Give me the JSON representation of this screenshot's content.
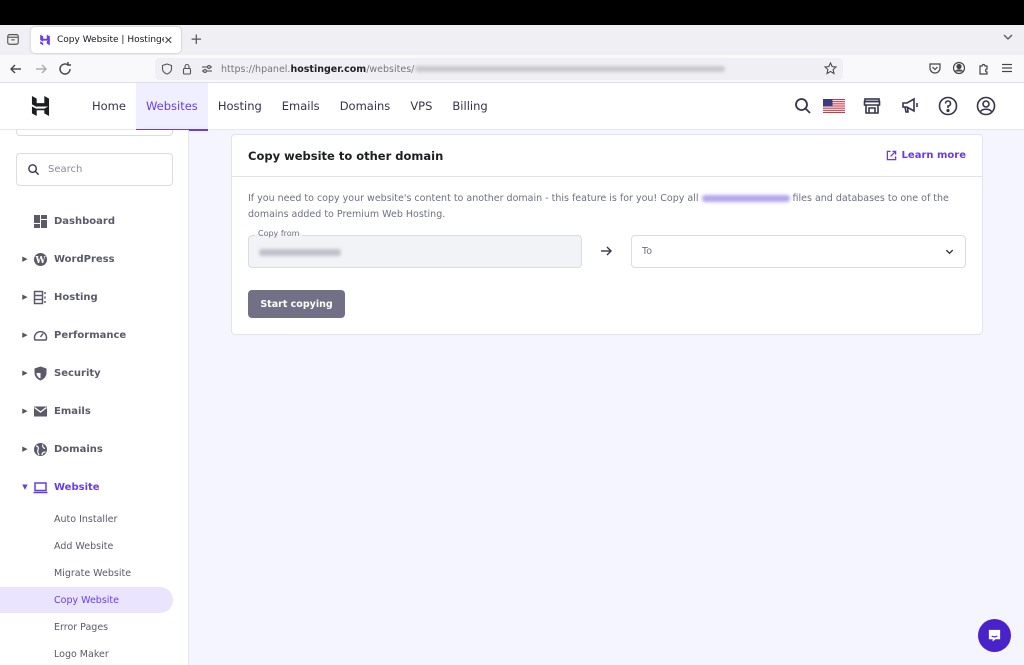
{
  "browser": {
    "tab": {
      "title": "Copy Website | Hostinger"
    },
    "url": {
      "prefix": "https://hpanel.",
      "domain": "hostinger.com",
      "path": "/websites/"
    }
  },
  "header": {
    "nav": [
      {
        "label": "Home",
        "active": false
      },
      {
        "label": "Websites",
        "active": true
      },
      {
        "label": "Hosting",
        "active": false
      },
      {
        "label": "Emails",
        "active": false
      },
      {
        "label": "Domains",
        "active": false
      },
      {
        "label": "VPS",
        "active": false
      },
      {
        "label": "Billing",
        "active": false
      }
    ],
    "icons": [
      "search-icon",
      "us-flag-icon",
      "store-icon",
      "megaphone-icon",
      "help-icon",
      "account-icon"
    ]
  },
  "sidebar": {
    "search_placeholder": "Search",
    "items": [
      {
        "label": "Dashboard",
        "icon": "dashboard-icon",
        "expandable": false
      },
      {
        "label": "WordPress",
        "icon": "wordpress-icon",
        "expandable": true
      },
      {
        "label": "Hosting",
        "icon": "hosting-icon",
        "expandable": true
      },
      {
        "label": "Performance",
        "icon": "gauge-icon",
        "expandable": true
      },
      {
        "label": "Security",
        "icon": "shield-icon",
        "expandable": true
      },
      {
        "label": "Emails",
        "icon": "mail-icon",
        "expandable": true
      },
      {
        "label": "Domains",
        "icon": "globe-icon",
        "expandable": true
      },
      {
        "label": "Website",
        "icon": "laptop-icon",
        "expandable": true,
        "open": true
      }
    ],
    "subitems": [
      {
        "label": "Auto Installer"
      },
      {
        "label": "Add Website"
      },
      {
        "label": "Migrate Website"
      },
      {
        "label": "Copy Website",
        "active": true
      },
      {
        "label": "Error Pages"
      },
      {
        "label": "Logo Maker"
      }
    ]
  },
  "card": {
    "title": "Copy website to other domain",
    "learn_more": "Learn more",
    "description_before": "If you need to copy your website's content to another domain - this feature is for you! Copy all",
    "description_after": "files and databases to one of the domains added to Premium Web Hosting.",
    "copy_from_label": "Copy from",
    "to_placeholder": "To",
    "start_button": "Start copying"
  },
  "colors": {
    "accent": "#673de6",
    "button_disabled": "#727086",
    "chat": "#4a22c9"
  }
}
